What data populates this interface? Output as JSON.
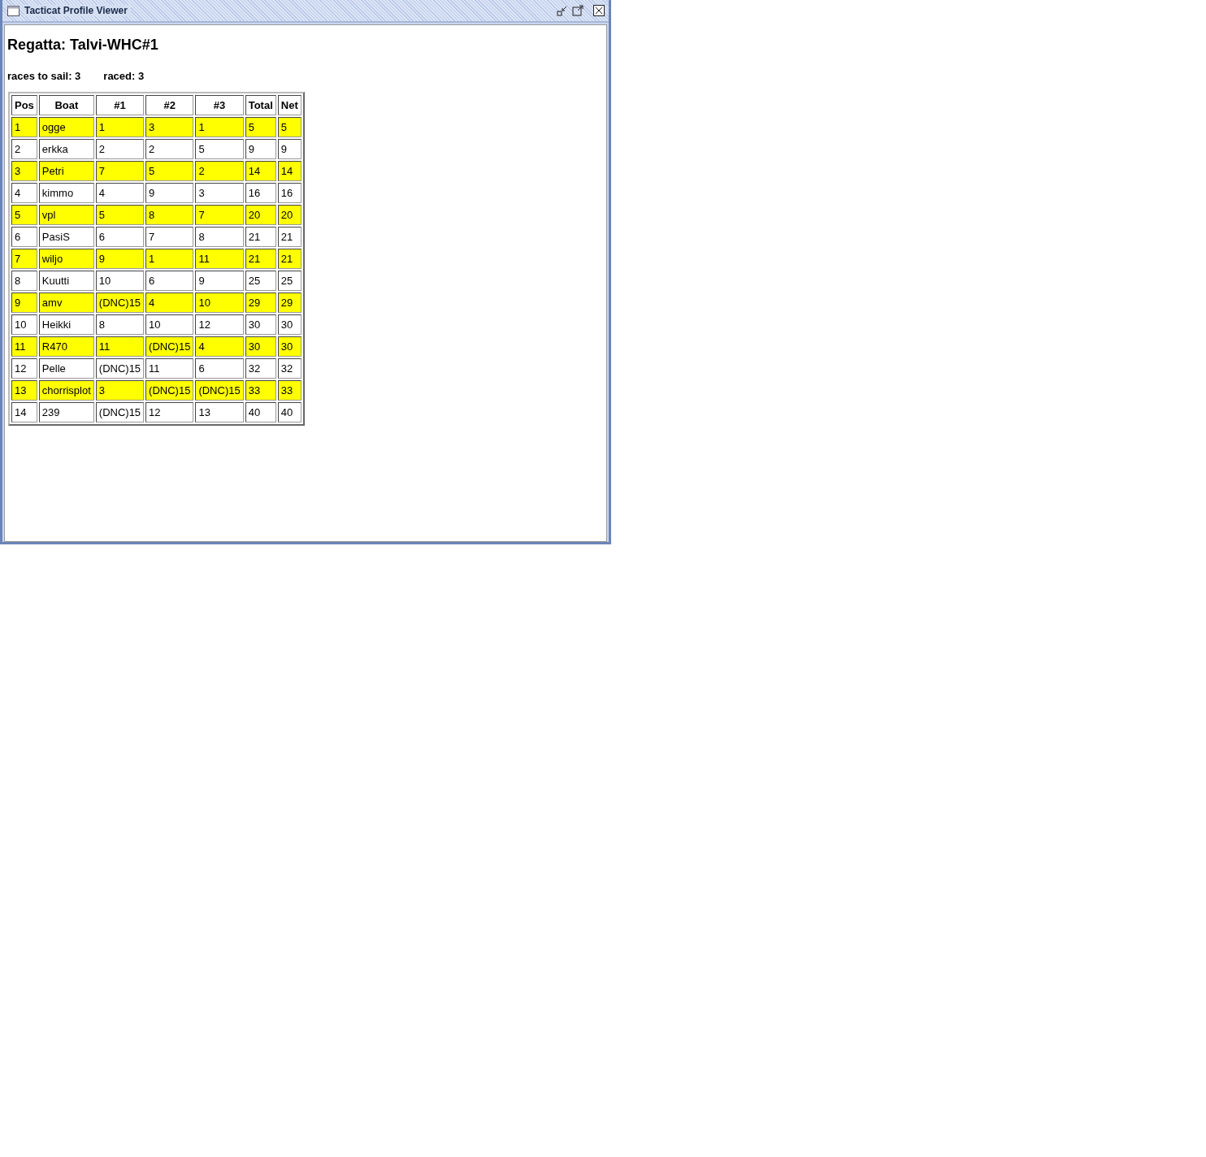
{
  "window": {
    "title": "Tacticat Profile Viewer"
  },
  "heading": "Regatta: Talvi-WHC#1",
  "summary": [
    {
      "label": "races to sail: 3"
    },
    {
      "label": "raced: 3"
    }
  ],
  "table": {
    "columns": [
      "Pos",
      "Boat",
      "#1",
      "#2",
      "#3",
      "Total",
      "Net"
    ],
    "rows": [
      {
        "highlighted": true,
        "cells": [
          "1",
          "ogge",
          "1",
          "3",
          "1",
          "5",
          "5"
        ]
      },
      {
        "highlighted": false,
        "cells": [
          "2",
          "erkka",
          "2",
          "2",
          "5",
          "9",
          "9"
        ]
      },
      {
        "highlighted": true,
        "cells": [
          "3",
          "Petri",
          "7",
          "5",
          "2",
          "14",
          "14"
        ]
      },
      {
        "highlighted": false,
        "cells": [
          "4",
          "kimmo",
          "4",
          "9",
          "3",
          "16",
          "16"
        ]
      },
      {
        "highlighted": true,
        "cells": [
          "5",
          "vpl",
          "5",
          "8",
          "7",
          "20",
          "20"
        ]
      },
      {
        "highlighted": false,
        "cells": [
          "6",
          "PasiS",
          "6",
          "7",
          "8",
          "21",
          "21"
        ]
      },
      {
        "highlighted": true,
        "cells": [
          "7",
          "wiljo",
          "9",
          "1",
          "11",
          "21",
          "21"
        ]
      },
      {
        "highlighted": false,
        "cells": [
          "8",
          "Kuutti",
          "10",
          "6",
          "9",
          "25",
          "25"
        ]
      },
      {
        "highlighted": true,
        "cells": [
          "9",
          "amv",
          "(DNC)15",
          "4",
          "10",
          "29",
          "29"
        ]
      },
      {
        "highlighted": false,
        "cells": [
          "10",
          "Heikki",
          "8",
          "10",
          "12",
          "30",
          "30"
        ]
      },
      {
        "highlighted": true,
        "cells": [
          "11",
          "R470",
          "11",
          "(DNC)15",
          "4",
          "30",
          "30"
        ]
      },
      {
        "highlighted": false,
        "cells": [
          "12",
          "Pelle",
          "(DNC)15",
          "11",
          "6",
          "32",
          "32"
        ]
      },
      {
        "highlighted": true,
        "cells": [
          "13",
          "chorrisplot",
          "3",
          "(DNC)15",
          "(DNC)15",
          "33",
          "33"
        ]
      },
      {
        "highlighted": false,
        "cells": [
          "14",
          "239",
          "(DNC)15",
          "12",
          "13",
          "40",
          "40"
        ]
      }
    ]
  }
}
